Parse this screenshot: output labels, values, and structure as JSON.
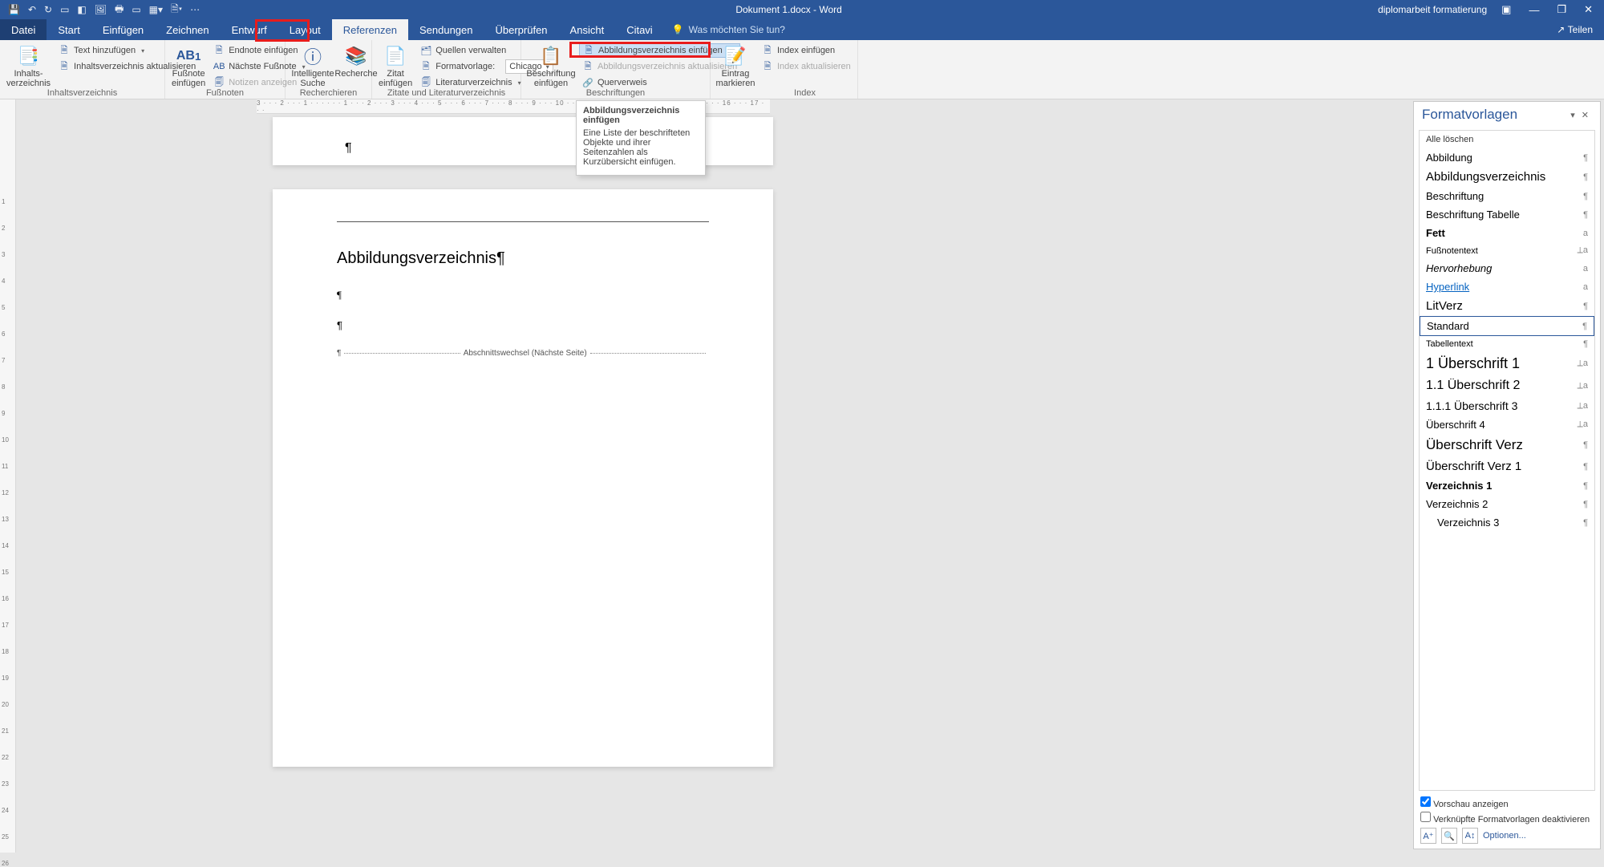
{
  "title": "Dokument 1.docx - Word",
  "account": "diplomarbeit formatierung",
  "share": "Teilen",
  "tabs": {
    "file": "Datei",
    "items": [
      "Start",
      "Einfügen",
      "Zeichnen",
      "Entwurf",
      "Layout",
      "Referenzen",
      "Sendungen",
      "Überprüfen",
      "Ansicht",
      "Citavi"
    ],
    "active": "Referenzen",
    "tellme": "Was möchten Sie tun?"
  },
  "ribbon": {
    "g1": {
      "label": "Inhaltsverzeichnis",
      "big": "Inhalts-\nverzeichnis",
      "a": "Text hinzufügen",
      "b": "Inhaltsverzeichnis aktualisieren"
    },
    "g2": {
      "label": "Fußnoten",
      "big": "Fußnote\neinfügen",
      "ab": "AB",
      "a": "Endnote einfügen",
      "b": "Nächste Fußnote",
      "c": "Notizen anzeigen"
    },
    "g3": {
      "label": "Recherchieren",
      "a": "Intelligente\nSuche",
      "b": "Recherche"
    },
    "g4": {
      "label": "Zitate und Literaturverzeichnis",
      "big": "Zitat\neinfügen",
      "a": "Quellen verwalten",
      "b": "Formatvorlage:",
      "bval": "Chicago",
      "c": "Literaturverzeichnis"
    },
    "g5": {
      "label": "Beschriftungen",
      "big": "Beschriftung\neinfügen",
      "a": "Abbildungsverzeichnis einfügen",
      "b": "Abbildungsverzeichnis aktualisieren",
      "c": "Querverweis"
    },
    "g6": {
      "label": "",
      "big": "Eintrag\nmarkieren"
    },
    "g7": {
      "label": "Index",
      "a": "Index einfügen",
      "b": "Index aktualisieren"
    }
  },
  "tooltip": {
    "title": "Abbildungsverzeichnis einfügen",
    "body": "Eine Liste der beschrifteten Objekte und ihrer Seitenzahlen als Kurzübersicht einfügen."
  },
  "ruler_h": "3 · · · 2 · · · 1 · · ·   · · · 1 · · · 2 · · · 3 · · · 4 · · · 5 · · · 6 · · · 7 · · · 8 · · · 9 · · · 10 · · · 11 · · · 12 · · · 13 · · · 14 · · · 15 · · · 16 · · · 17 · · ·",
  "doc": {
    "heading": "Abbildungsverzeichnis¶",
    "sect": "Abschnittswechsel (Nächste Seite)"
  },
  "pane": {
    "title": "Formatvorlagen",
    "all": "Alle löschen",
    "styles": [
      {
        "name": "Abbildung",
        "sym": "¶",
        "center": true
      },
      {
        "name": "Abbildungsverzeichnis",
        "sym": "¶",
        "size": "15px"
      },
      {
        "name": "Beschriftung",
        "sym": "¶"
      },
      {
        "name": "Beschriftung Tabelle",
        "sym": "¶"
      },
      {
        "name": "Fett",
        "sym": "a",
        "bold": true
      },
      {
        "name": "Fußnotentext",
        "sym": "⟂a",
        "size": "11px"
      },
      {
        "name": "Hervorhebung",
        "sym": "a",
        "ital": true
      },
      {
        "name": "Hyperlink",
        "sym": "a",
        "link": true
      },
      {
        "name": "LitVerz",
        "sym": "¶",
        "size": "15px"
      },
      {
        "name": "Standard",
        "sym": "¶",
        "sel": true
      },
      {
        "name": "Tabellentext",
        "sym": "¶",
        "size": "11px"
      },
      {
        "name": "1  Überschrift 1",
        "sym": "⟂a",
        "size": "18px"
      },
      {
        "name": "1.1  Überschrift 2",
        "sym": "⟂a",
        "size": "16px"
      },
      {
        "name": "1.1.1  Überschrift 3",
        "sym": "⟂a",
        "size": "14px"
      },
      {
        "name": "Überschrift 4",
        "sym": "⟂a"
      },
      {
        "name": "Überschrift Verz",
        "sym": "¶",
        "size": "17px"
      },
      {
        "name": "Überschrift Verz 1",
        "sym": "¶",
        "size": "15px"
      },
      {
        "name": "Verzeichnis 1",
        "sym": "¶",
        "bold": true
      },
      {
        "name": "Verzeichnis 2",
        "sym": "¶"
      },
      {
        "name": "Verzeichnis 3",
        "sym": "¶",
        "indent": true
      }
    ],
    "chk1": "Vorschau anzeigen",
    "chk2": "Verknüpfte Formatvorlagen deaktivieren",
    "opt": "Optionen..."
  }
}
